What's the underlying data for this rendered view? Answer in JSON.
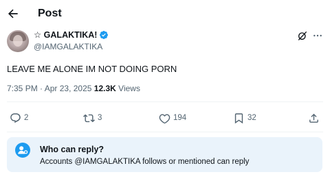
{
  "header": {
    "title": "Post",
    "back_icon": "arrow-left-icon"
  },
  "author": {
    "display_name": "☆ GALAKTIKA!",
    "handle": "@IAMGALAKTIKA",
    "verified_color": "#1d9bf0"
  },
  "post": {
    "text": "LEAVE ME ALONE IM NOT DOING PORN",
    "time": "7:35 PM",
    "separator": "·",
    "date": "Apr 23, 2025",
    "views_count": "12.3K",
    "views_label": "Views"
  },
  "actions": {
    "replies": "2",
    "reposts": "3",
    "likes": "194",
    "bookmarks": "32"
  },
  "reply_restriction": {
    "title": "Who can reply?",
    "description": "Accounts @IAMGALAKTIKA follows or mentioned can reply",
    "accent": "#1d9bf0"
  }
}
